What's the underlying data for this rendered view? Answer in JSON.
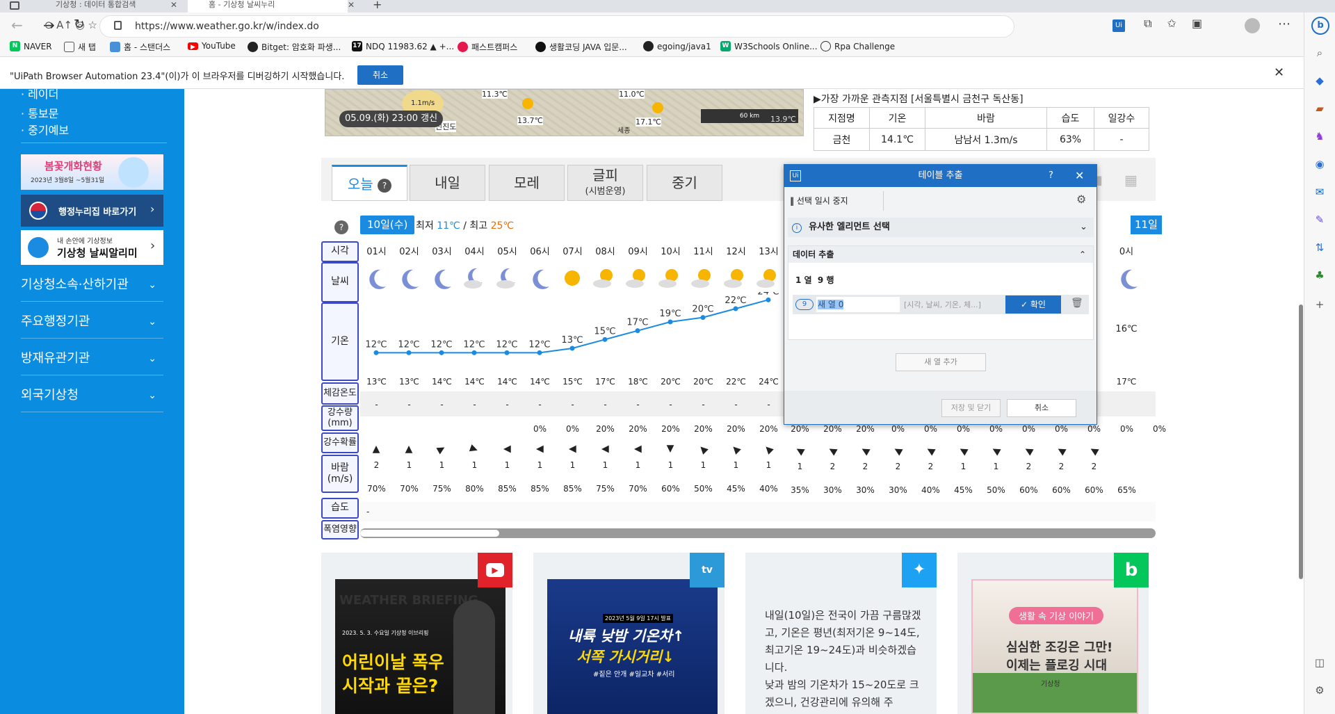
{
  "browser": {
    "tabs": [
      {
        "title": "기상청 : 데이터 통합검색"
      },
      {
        "title": "홈 - 기상청 날씨누리"
      }
    ],
    "url": "https://www.weather.go.kr/w/index.do",
    "bookmarks": [
      {
        "label": "NAVER",
        "icon": "naver-icon",
        "color": "#03c75a"
      },
      {
        "label": "새 탭",
        "icon": "newtab-icon",
        "color": "#555555"
      },
      {
        "label": "홈 - 스탠더스",
        "icon": "site-icon",
        "color": "#4a90d9"
      },
      {
        "label": "YouTube",
        "icon": "youtube-icon",
        "color": "#ff0000"
      },
      {
        "label": "Bitget: 암호화 파생...",
        "icon": "bitget-icon",
        "color": "#222222"
      },
      {
        "label": "NDQ 11983.62 ▲ +...",
        "icon": "tradingview-icon",
        "color": "#111111"
      },
      {
        "label": "패스트캠퍼스",
        "icon": "fastcampus-icon",
        "color": "#e5174c"
      },
      {
        "label": "생활코딩 JAVA 입문...",
        "icon": "circle-icon",
        "color": "#111111"
      },
      {
        "label": "egoing/java1",
        "icon": "github-icon",
        "color": "#222222"
      },
      {
        "label": "W3Schools Online...",
        "icon": "w3schools-icon",
        "color": "#04aa6d"
      },
      {
        "label": "Rpa Challenge",
        "icon": "robot-icon",
        "color": "#333333"
      }
    ]
  },
  "infobar": {
    "message": "\"UiPath Browser Automation 23.4\"(이)가 이 브라우저를 디버깅하기 시작했습니다.",
    "cancel_label": "취소"
  },
  "leftnav": {
    "links": [
      "· 레이더",
      "· 통보문",
      "· 중기예보"
    ],
    "banner_title": "봄꽃개화현황",
    "banner_date": "2023년 3월8일 ~5월31일",
    "gov_label": "행정누리집 바로가기",
    "app_small": "내 손안에 기상정보",
    "app_big": "기상청 날씨알리미",
    "sections": [
      "기상청소속·산하기관",
      "주요행정기관",
      "방재유관기관",
      "외국기상청"
    ]
  },
  "map": {
    "updated": "05.09.(화) 23:00 갱신",
    "labels": [
      "11.3℃",
      "13.7℃",
      "11.0℃",
      "17.1℃",
      "신진도",
      "세종",
      "1.1m/s",
      "60 km",
      "13.9℃"
    ]
  },
  "nearest": {
    "title": "▶가장 가까운 관측지점 [서울특별시 금천구 독산동]",
    "headers": [
      "지점명",
      "기온",
      "바람",
      "습도",
      "일강수"
    ],
    "row": [
      "금천",
      "14.1℃",
      "남남서 1.3m/s",
      "63%",
      "-"
    ]
  },
  "forecast": {
    "tabs": [
      "오늘",
      "내일",
      "모레",
      "글피",
      "중기"
    ],
    "tab_sub": "(시범운영)",
    "day_badge": "10일(수)",
    "min_label": "최저",
    "min_val": "11℃",
    "max_label": "최고",
    "max_val": "25℃",
    "next_badge": "11일",
    "row_labels": [
      "시각",
      "날씨",
      "기온",
      "체감온도",
      "강수량\n(mm)",
      "강수확률",
      "바람\n(m/s)",
      "습도",
      "폭염영향"
    ],
    "hours": [
      "01시",
      "02시",
      "03시",
      "04시",
      "05시",
      "06시",
      "07시",
      "08시",
      "09시",
      "10시",
      "11시",
      "12시",
      "13시"
    ],
    "weather": [
      "moon",
      "moon",
      "moon",
      "moon-cloud",
      "moon-cloud",
      "moon",
      "sun",
      "sun-cloud",
      "sun-cloud",
      "sun-cloud",
      "sun-cloud",
      "sun-cloud",
      "sun-cloud"
    ],
    "temps": [
      12,
      12,
      12,
      12,
      12,
      12,
      13,
      15,
      17,
      19,
      20,
      22,
      24
    ],
    "feels": [
      "13℃",
      "13℃",
      "14℃",
      "14℃",
      "14℃",
      "14℃",
      "15℃",
      "17℃",
      "18℃",
      "20℃",
      "20℃",
      "22℃",
      "24℃"
    ],
    "precip": [
      "-",
      "-",
      "-",
      "-",
      "-",
      "-",
      "-",
      "-",
      "-",
      "-",
      "-",
      "-",
      "-"
    ],
    "prob": [
      "",
      "",
      "",
      "",
      "",
      "0%",
      "0%",
      "20%",
      "20%",
      "20%",
      "20%",
      "20%",
      "20%"
    ],
    "wind_speed": [
      "2",
      "1",
      "1",
      "1",
      "1",
      "1",
      "1",
      "1",
      "1",
      "1",
      "1",
      "1",
      "1"
    ],
    "wind_dir": [
      0,
      0,
      60,
      110,
      270,
      270,
      270,
      270,
      270,
      180,
      315,
      315,
      315
    ],
    "humidity": [
      "70%",
      "70%",
      "75%",
      "80%",
      "85%",
      "85%",
      "85%",
      "75%",
      "70%",
      "60%",
      "50%",
      "45%",
      "40%"
    ],
    "right_hours": [
      "0시"
    ],
    "right_temps": [
      "16℃"
    ],
    "right_feels": [
      "17℃"
    ],
    "right_prob": [
      "20%",
      "20%",
      "20%",
      "0%",
      "0%",
      "0%",
      "0%",
      "0%",
      "0%",
      "0%",
      "0%",
      "0%"
    ],
    "right_wind": [
      "1",
      "2",
      "2",
      "2",
      "2",
      "1",
      "1",
      "2",
      "2",
      "2"
    ],
    "right_hum": [
      "35%",
      "30%",
      "30%",
      "30%",
      "40%",
      "45%",
      "50%",
      "60%",
      "60%",
      "60%",
      "65%"
    ],
    "heat_val": "-"
  },
  "dialog": {
    "title": "테이블 추출",
    "help": "?",
    "pause_label": "선택 일시 중지",
    "similar_label": "유사한 엘리먼트 선택",
    "extract_label": "데이터 추출",
    "count_label": "1 열  9 행",
    "col_badge": "9",
    "col_name": "새 열 0",
    "col_preview": "[시각, 날씨, 기온, 체...]",
    "confirm_label": "확인",
    "add_col_label": "새 열 추가",
    "save_label": "저장 및 닫기",
    "cancel_label": "취소"
  },
  "cards": {
    "youtube_line1": "2023. 5. 3. 수요일 기상청 이브리핑",
    "youtube_line2": "어린이날 폭우",
    "youtube_line3": "시작과 끝은?",
    "youtube_bg": "WEATHER BRIEFING",
    "tv_date": "2023년 5월 9일 17시 발표",
    "tv_line1": "내륙 낮밤 기온차↑",
    "tv_line2": "서쪽 가시거리↓",
    "tv_tags": "#짙은 안개 #일교차 #서리",
    "twitter_text": "내일(10일)은 전국이 가끔 구름많겠고, 기온은 평년(최저기온 9~14도, 최고기온 19~24도)과 비슷하겠습니다.\n낮과 밤의 기온차가 15~20도로 크겠으니, 건강관리에 유의해 주",
    "blog_tag": "생활 속 기상 이야기",
    "blog_line1": "심심한 조깅은 그만!",
    "blog_line2": "이제는 플로깅 시대",
    "blog_org": "기상청"
  }
}
